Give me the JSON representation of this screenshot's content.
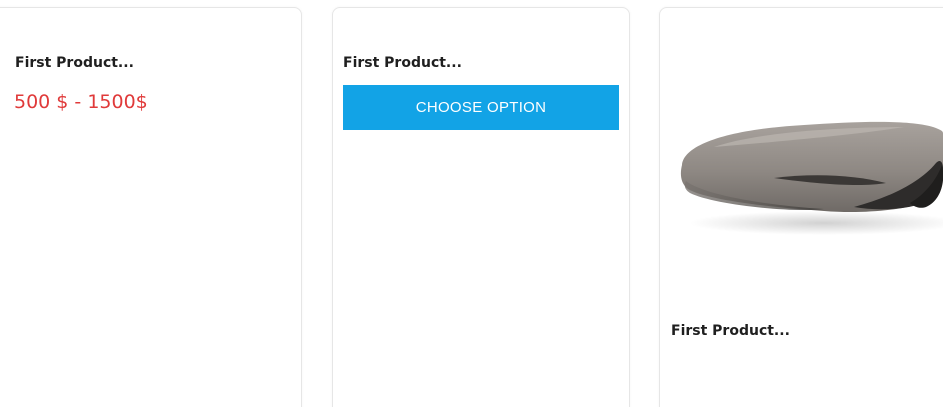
{
  "cards": [
    {
      "title": "First Product...",
      "price": "500 $ - 1500$"
    },
    {
      "title": "First Product...",
      "button_label": "CHOOSE OPTION"
    },
    {
      "title": "First Product...",
      "image": "seat-cushion-product-image"
    }
  ],
  "colors": {
    "price": "#e03a3a",
    "button_bg": "#12a3e6",
    "button_text": "#ffffff",
    "card_border": "#e6e6e6"
  }
}
